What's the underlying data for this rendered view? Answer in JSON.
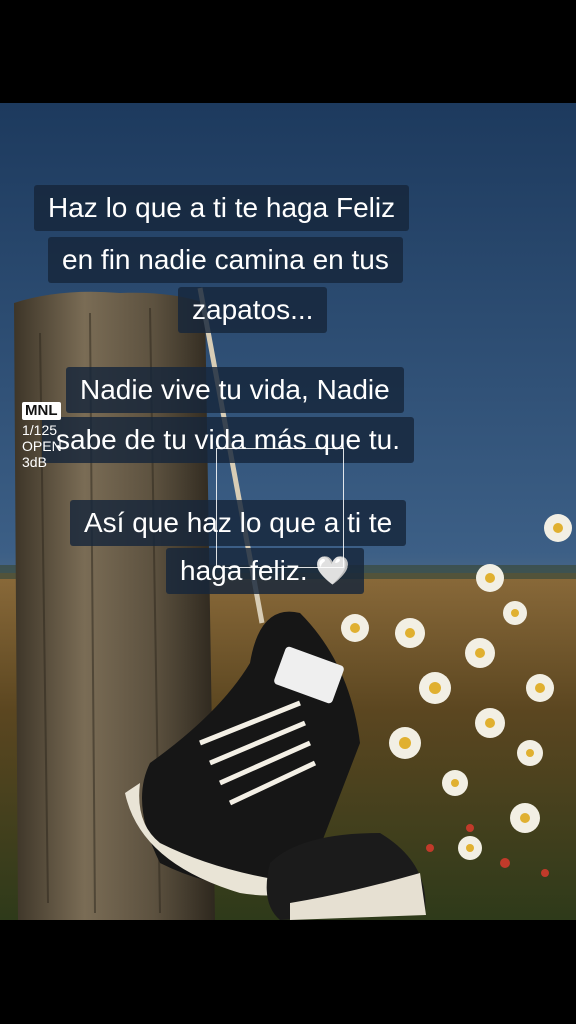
{
  "captions": {
    "line1": "Haz lo que a ti te haga Feliz",
    "line2": "en fin nadie camina en tus",
    "line3": "zapatos...",
    "line4": "Nadie vive tu vida, Nadie",
    "line5": "sabe de tu vida más que tu.",
    "line6": "Así que haz lo que a ti te",
    "line7": "haga feliz.",
    "heart": "🤍"
  },
  "camera_overlay": {
    "mode": "MNL",
    "shutter": "1/125",
    "aperture": "OPEN",
    "gain": "3dB"
  },
  "scene": {
    "subject": "sneakers hanging on wooden post",
    "sky_color": "#1f3f66",
    "field_color": "#4a3a1e",
    "shoe_color": "#1a1a1a",
    "flower_petal_color": "#f2efe4",
    "flower_center_color": "#e0b030"
  }
}
